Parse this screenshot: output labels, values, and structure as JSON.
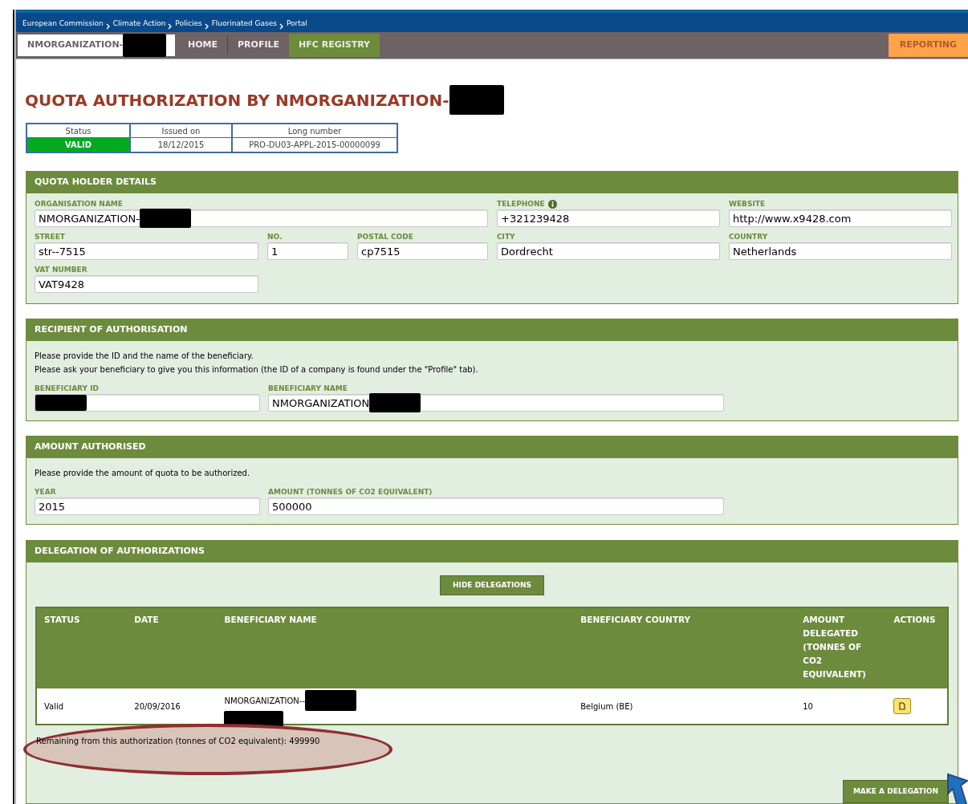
{
  "breadcrumb": [
    "European Commission",
    "Climate Action",
    "Policies",
    "Fluorinated Gases",
    "Portal"
  ],
  "nav": {
    "organisation": {
      "label": "NMORGANIZATION-",
      "redacted": true
    },
    "tabs": [
      {
        "label": "HOME",
        "selected": false
      },
      {
        "label": "PROFILE",
        "selected": false
      },
      {
        "label": "HFC REGISTRY",
        "selected": true
      }
    ],
    "reporting": "REPORTING"
  },
  "title": {
    "text": "QUOTA AUTHORIZATION BY NMORGANIZATION-",
    "redacted": true
  },
  "summary": [
    {
      "label": "Status",
      "value": "VALID",
      "kind": "status"
    },
    {
      "label": "Issued on",
      "value": "18/12/2015",
      "kind": "text"
    },
    {
      "label": "Long number",
      "value": "PRO-DU03-APPL-2015-00000099",
      "kind": "text"
    }
  ],
  "quota_holder": {
    "title": "QUOTA HOLDER DETAILS",
    "fields": [
      {
        "label": "ORGANISATION NAME",
        "value": "NMORGANIZATION-",
        "redacted": true,
        "info": false
      },
      {
        "label": "TELEPHONE",
        "value": "+321239428",
        "redacted": false,
        "info": true
      },
      {
        "label": "WEBSITE",
        "value": "http://www.x9428.com",
        "redacted": false,
        "info": false
      },
      {
        "label": "STREET",
        "value": "str--7515",
        "redacted": false,
        "info": false
      },
      {
        "label": "NO.",
        "value": "1",
        "redacted": false,
        "info": false
      },
      {
        "label": "POSTAL CODE",
        "value": "cp7515",
        "redacted": false,
        "info": false
      },
      {
        "label": "CITY",
        "value": "Dordrecht",
        "redacted": false,
        "info": false
      },
      {
        "label": "COUNTRY",
        "value": "Netherlands",
        "redacted": false,
        "info": false
      },
      {
        "label": "VAT NUMBER",
        "value": "VAT9428",
        "redacted": false,
        "info": false
      }
    ]
  },
  "recipient": {
    "title": "RECIPIENT OF AUTHORISATION",
    "notes": [
      "Please provide the ID and the name of the beneficiary.",
      "Please ask your beneficiary to give you this information (the ID of a company is found under the \"Profile\" tab)."
    ],
    "fields": [
      {
        "label": "BENEFICIARY ID",
        "redacted": true
      },
      {
        "label": "BENEFICIARY NAME",
        "value": "NMORGANIZATION",
        "redacted": true
      }
    ]
  },
  "amount": {
    "title": "AMOUNT AUTHORISED",
    "notes": [
      "Please provide the amount of quota to be authorized."
    ],
    "fields": [
      {
        "label": "YEAR",
        "value": "2015",
        "redacted": false
      },
      {
        "label": "AMOUNT (TONNES OF CO2 EQUIVALENT)",
        "value": "500000",
        "redacted": false
      }
    ]
  },
  "delegation": {
    "title": "DELEGATION OF AUTHORIZATIONS",
    "toggle_button": "HIDE DELEGATIONS",
    "table": {
      "columns": [
        "STATUS",
        "DATE",
        "BENEFICIARY NAME",
        "BENEFICIARY COUNTRY",
        "AMOUNT DELEGATED (TONNES OF CO2 EQUIVALENT)",
        "ACTIONS"
      ],
      "rows": [
        {
          "status": "Valid",
          "date": "20/09/2016",
          "beneficiary_name": "NMORGANIZATION--",
          "redacted": true,
          "country": "Belgium (BE)",
          "amount": "10"
        }
      ]
    },
    "remaining": {
      "text": "Remaining from this authorization (tonnes of CO2 equivalent): 499990",
      "highlighted": true
    },
    "make_button": "MAKE A DELEGATION"
  }
}
